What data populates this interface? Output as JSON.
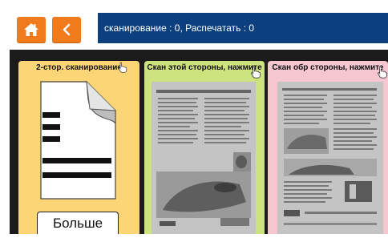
{
  "topbar": {
    "home_icon": "home-icon",
    "back_icon": "chevron-left-icon",
    "status_text": "сканирование : 0, Распечатать : 0"
  },
  "cards": [
    {
      "title": "2-стор. сканирование",
      "icon": "document-icon",
      "button_label": "Больше",
      "color": "#fcd676"
    },
    {
      "title": "Скан этой стороны, нажмите",
      "thumb_icon": "scanned-page-front",
      "color": "#cde37e"
    },
    {
      "title": "Скан обр стороны, нажмите",
      "thumb_icon": "scanned-page-back",
      "color": "#f6c7d1"
    }
  ],
  "colors": {
    "accent": "#f07b1c",
    "status_bar": "#0c3f7d",
    "panel": "#1b1b1b"
  }
}
